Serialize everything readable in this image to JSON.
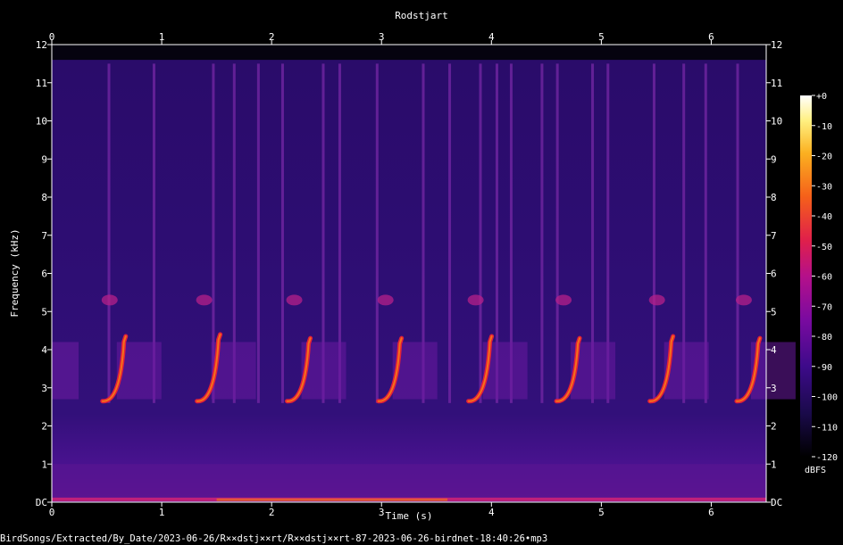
{
  "chart_data": {
    "type": "heatmap",
    "title": "Rodstjart",
    "xlabel": "Time (s)",
    "ylabel": "Frequency (kHz)",
    "xlim": [
      0,
      6.5
    ],
    "ylim": [
      0,
      12
    ],
    "x_ticks": [
      "0",
      "1",
      "2",
      "3",
      "4",
      "5",
      "6"
    ],
    "x_tick_values": [
      0,
      1,
      2,
      3,
      4,
      5,
      6
    ],
    "y_ticks": [
      "DC",
      "1",
      "2",
      "3",
      "4",
      "5",
      "6",
      "7",
      "8",
      "9",
      "10",
      "11",
      "12"
    ],
    "y_tick_values": [
      0,
      1,
      2,
      3,
      4,
      5,
      6,
      7,
      8,
      9,
      10,
      11,
      12
    ],
    "colorbar": {
      "label": "dBFS",
      "ticks": [
        "+0",
        "-10",
        "-20",
        "-30",
        "-40",
        "-50",
        "-60",
        "-70",
        "-80",
        "-90",
        "-100",
        "-110",
        "-120"
      ],
      "range": [
        -120,
        0
      ],
      "colors": [
        "#000000",
        "#1a0a4a",
        "#3d0a8a",
        "#7a0aa0",
        "#b5108a",
        "#e0204a",
        "#f5601a",
        "#fbb020",
        "#fff080",
        "#ffffff"
      ]
    },
    "background_level_dbfs": -95,
    "calls": [
      {
        "t": 0.64,
        "f_low": 2.65,
        "f_high": 4.35
      },
      {
        "t": 1.5,
        "f_low": 2.65,
        "f_high": 4.4
      },
      {
        "t": 2.32,
        "f_low": 2.65,
        "f_high": 4.3
      },
      {
        "t": 3.15,
        "f_low": 2.65,
        "f_high": 4.3
      },
      {
        "t": 3.97,
        "f_low": 2.65,
        "f_high": 4.35
      },
      {
        "t": 4.77,
        "f_low": 2.65,
        "f_high": 4.3
      },
      {
        "t": 5.62,
        "f_low": 2.65,
        "f_high": 4.35
      },
      {
        "t": 6.41,
        "f_low": 2.65,
        "f_high": 4.3
      }
    ],
    "clicks": [
      0.52,
      0.93,
      1.47,
      1.66,
      1.88,
      2.1,
      2.47,
      2.62,
      2.96,
      3.38,
      3.62,
      3.9,
      4.05,
      4.18,
      4.46,
      4.6,
      4.92,
      5.06,
      5.48,
      5.75,
      5.95,
      6.24
    ]
  },
  "footer": {
    "path": "BirdSongs/Extracted/By_Date/2023-06-26/R××dstj××rt/R××dstj××rt-87-2023-06-26-birdnet-18:40:26•mp3"
  }
}
